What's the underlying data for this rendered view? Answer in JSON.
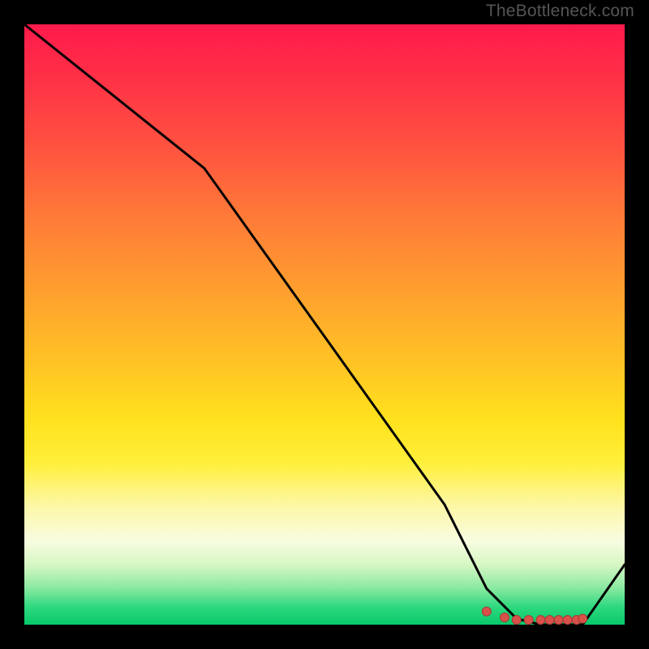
{
  "attribution": "TheBottleneck.com",
  "colors": {
    "frame_bg": "#000000",
    "line": "#000000",
    "marker_fill": "#d8524a",
    "marker_stroke": "#a53a34",
    "gradient_top": "#ff1a4b",
    "gradient_bottom": "#08c96a"
  },
  "chart_data": {
    "type": "line",
    "title": "",
    "xlabel": "",
    "ylabel": "",
    "xlim": [
      0,
      100
    ],
    "ylim": [
      0,
      100
    ],
    "x": [
      0,
      10,
      20,
      30,
      40,
      50,
      60,
      70,
      77,
      82,
      86,
      90,
      93,
      100
    ],
    "values": [
      100,
      92,
      84,
      76,
      62,
      48,
      34,
      20,
      6,
      1,
      0,
      0,
      0,
      10
    ],
    "markers_x": [
      77,
      80,
      82,
      84,
      86,
      87.5,
      89,
      90.5,
      92,
      93
    ],
    "markers_y": [
      2.2,
      1.2,
      0.8,
      0.8,
      0.8,
      0.8,
      0.8,
      0.8,
      0.8,
      1.0
    ],
    "note": "x/y are percentages of plot area (0 bottom-left, 100 top-right). Line goes from top-left down to a flat minimum near x≈82–93 then ticks up at right edge. Markers cluster along the flat minimum."
  }
}
